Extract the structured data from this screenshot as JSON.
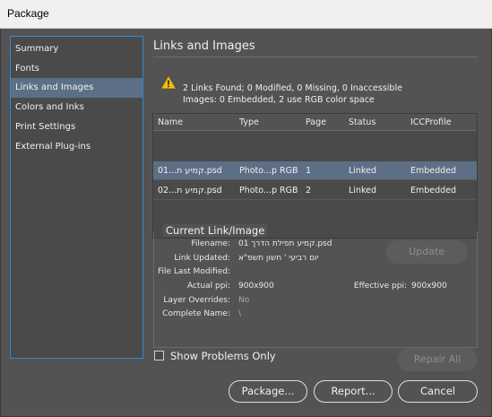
{
  "window": {
    "title": "Package"
  },
  "sidebar": {
    "items": [
      {
        "label": "Summary"
      },
      {
        "label": "Fonts"
      },
      {
        "label": "Links and Images"
      },
      {
        "label": "Colors and Inks"
      },
      {
        "label": "Print Settings"
      },
      {
        "label": "External Plug-ins"
      }
    ],
    "selected_index": 2
  },
  "main": {
    "section_title": "Links and Images",
    "summary_line1": "2 Links Found; 0 Modified, 0 Missing, 0 Inaccessible",
    "summary_line2": "Images: 0 Embedded, 2 use RGB color space",
    "table": {
      "columns": [
        "Name",
        "Type",
        "Page",
        "Status",
        "ICCProfile"
      ],
      "rows": [
        {
          "name": "01...קמיע ת.psd",
          "type": "Photo...p RGB",
          "page": "1",
          "status": "Linked",
          "icc": "Embedded"
        },
        {
          "name": "02...קמיע ת.psd",
          "type": "Photo...p RGB",
          "page": "2",
          "status": "Linked",
          "icc": "Embedded"
        }
      ],
      "selected_row": 0
    },
    "current_link": {
      "title": "Current Link/Image",
      "filename_label": "Filename:",
      "filename_value": "קמיע תפילת הדרך 01.psd",
      "link_updated_label": "Link Updated:",
      "link_updated_value": "יום רביעי ' חשון תשפ\"א",
      "file_last_modified_label": "File Last Modified:",
      "file_last_modified_value": "",
      "actual_ppi_label": "Actual ppi:",
      "actual_ppi_value": "900x900",
      "effective_ppi_label": "Effective ppi:",
      "effective_ppi_value": "900x900",
      "layer_overrides_label": "Layer Overrides:",
      "layer_overrides_value": "No",
      "complete_name_label": "Complete Name:",
      "complete_name_value": "\\",
      "update_button": "Update"
    },
    "show_problems_label": "Show Problems Only",
    "repair_all_button": "Repair All"
  },
  "footer": {
    "package_button": "Package...",
    "report_button": "Report...",
    "cancel_button": "Cancel"
  },
  "colors": {
    "accent_selection": "#5d6f86",
    "sidebar_border": "#2e8ad6",
    "warning": "#f2c200",
    "background": "#535353"
  }
}
